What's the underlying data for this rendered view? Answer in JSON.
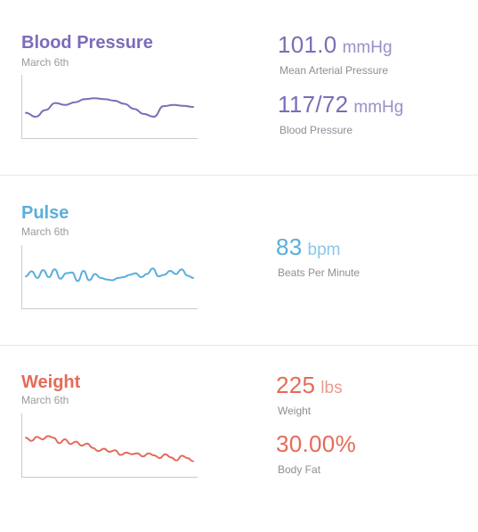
{
  "colors": {
    "blood_pressure": "#7d6cb8",
    "pulse": "#5aaedc",
    "weight": "#e56b58",
    "axis": "#c9c9cf",
    "divider": "#e6e7ea"
  },
  "cards": [
    {
      "title": "Blood Pressure",
      "date": "March 6th",
      "metrics": [
        {
          "value": "101.0",
          "unit": "mmHg",
          "label": "Mean Arterial Pressure"
        },
        {
          "value": "117/72",
          "unit": "mmHg",
          "label": "Blood Pressure"
        }
      ],
      "sparkline": [
        0.35,
        0.25,
        0.42,
        0.6,
        0.55,
        0.62,
        0.7,
        0.72,
        0.7,
        0.66,
        0.58,
        0.45,
        0.32,
        0.25,
        0.52,
        0.55,
        0.53,
        0.5
      ]
    },
    {
      "title": "Pulse",
      "date": "March 6th",
      "metrics": [
        {
          "value": "83",
          "unit": "bpm",
          "label": "Beats Per Minute"
        }
      ],
      "sparkline": [
        0.52,
        0.65,
        0.48,
        0.68,
        0.5,
        0.7,
        0.46,
        0.6,
        0.62,
        0.4,
        0.66,
        0.42,
        0.58,
        0.48,
        0.44,
        0.42,
        0.48,
        0.5,
        0.56,
        0.6,
        0.5,
        0.58,
        0.72,
        0.52,
        0.56,
        0.66,
        0.58,
        0.7,
        0.54,
        0.48
      ]
    },
    {
      "title": "Weight",
      "date": "March 6th",
      "metrics": [
        {
          "value": "225",
          "unit": "lbs",
          "label": "Weight"
        },
        {
          "value": "30.00%",
          "unit": "",
          "label": "Body Fat"
        }
      ],
      "sparkline": [
        0.7,
        0.62,
        0.72,
        0.66,
        0.74,
        0.7,
        0.56,
        0.66,
        0.54,
        0.6,
        0.5,
        0.55,
        0.44,
        0.36,
        0.42,
        0.34,
        0.38,
        0.26,
        0.32,
        0.28,
        0.3,
        0.22,
        0.3,
        0.25,
        0.18,
        0.28,
        0.2,
        0.12,
        0.24,
        0.18,
        0.1
      ]
    }
  ]
}
